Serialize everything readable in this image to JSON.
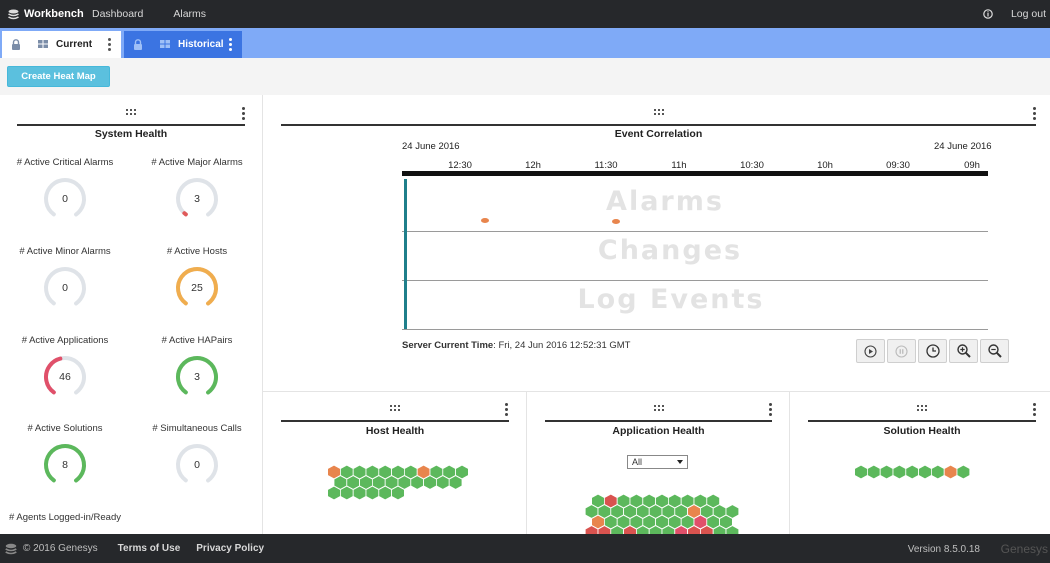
{
  "navbar": {
    "brand": "Workbench",
    "links": [
      "Dashboard",
      "Alarms"
    ],
    "logout": "Log out"
  },
  "tabs": [
    {
      "label": "Current",
      "active": true
    },
    {
      "label": "Historical",
      "active": false
    }
  ],
  "toolbar": {
    "create_heat_map": "Create Heat Map"
  },
  "system_health": {
    "title": "System Health",
    "gauges": [
      {
        "label": "# Active Critical Alarms",
        "value": "0",
        "color": "#dfe3e8",
        "fill": 0
      },
      {
        "label": "# Active Major Alarms",
        "value": "3",
        "color": "#e05a5a",
        "fill": 0.02
      },
      {
        "label": "# Active Minor Alarms",
        "value": "0",
        "color": "#dfe3e8",
        "fill": 0
      },
      {
        "label": "# Active Hosts",
        "value": "25",
        "color": "#f0ad4e",
        "fill": 1
      },
      {
        "label": "# Active Applications",
        "value": "46",
        "color": "#e0506a",
        "fill": 0.45
      },
      {
        "label": "# Active HAPairs",
        "value": "3",
        "color": "#5cb85c",
        "fill": 1
      },
      {
        "label": "# Active Solutions",
        "value": "8",
        "color": "#5cb85c",
        "fill": 1
      },
      {
        "label": "# Simultaneous Calls",
        "value": "0",
        "color": "#dfe3e8",
        "fill": 0
      },
      {
        "label": "# Agents Logged-in/Ready",
        "value": "",
        "color": "#dfe3e8",
        "fill": 0
      }
    ]
  },
  "event_correlation": {
    "title": "Event Correlation",
    "date_left": "24 June 2016",
    "date_right": "24 June 2016",
    "ticks": [
      "12:30",
      "12h",
      "11:30",
      "11h",
      "10:30",
      "10h",
      "09:30",
      "09h"
    ],
    "lanes": [
      "Alarms",
      "Changes",
      "Log Events"
    ],
    "server_time_label": "Server Current Time",
    "server_time_value": ": Fri, 24 Jun 2016 12:52:31 GMT",
    "controls": [
      "play-icon",
      "pause-icon",
      "clock-icon",
      "zoom-in-icon",
      "zoom-out-icon"
    ]
  },
  "host_health": {
    "title": "Host Health"
  },
  "application_health": {
    "title": "Application Health",
    "filter": "All"
  },
  "solution_health": {
    "title": "Solution Health"
  },
  "colors": {
    "ok": "#5cb85c",
    "warn": "#e8854d",
    "crit": "#d9534f",
    "pink": "#e0506a"
  },
  "footer": {
    "copyright": "© 2016 Genesys",
    "terms": "Terms of Use",
    "privacy": "Privacy Policy",
    "version": "Version 8.5.0.18",
    "brand": "Genesys"
  }
}
